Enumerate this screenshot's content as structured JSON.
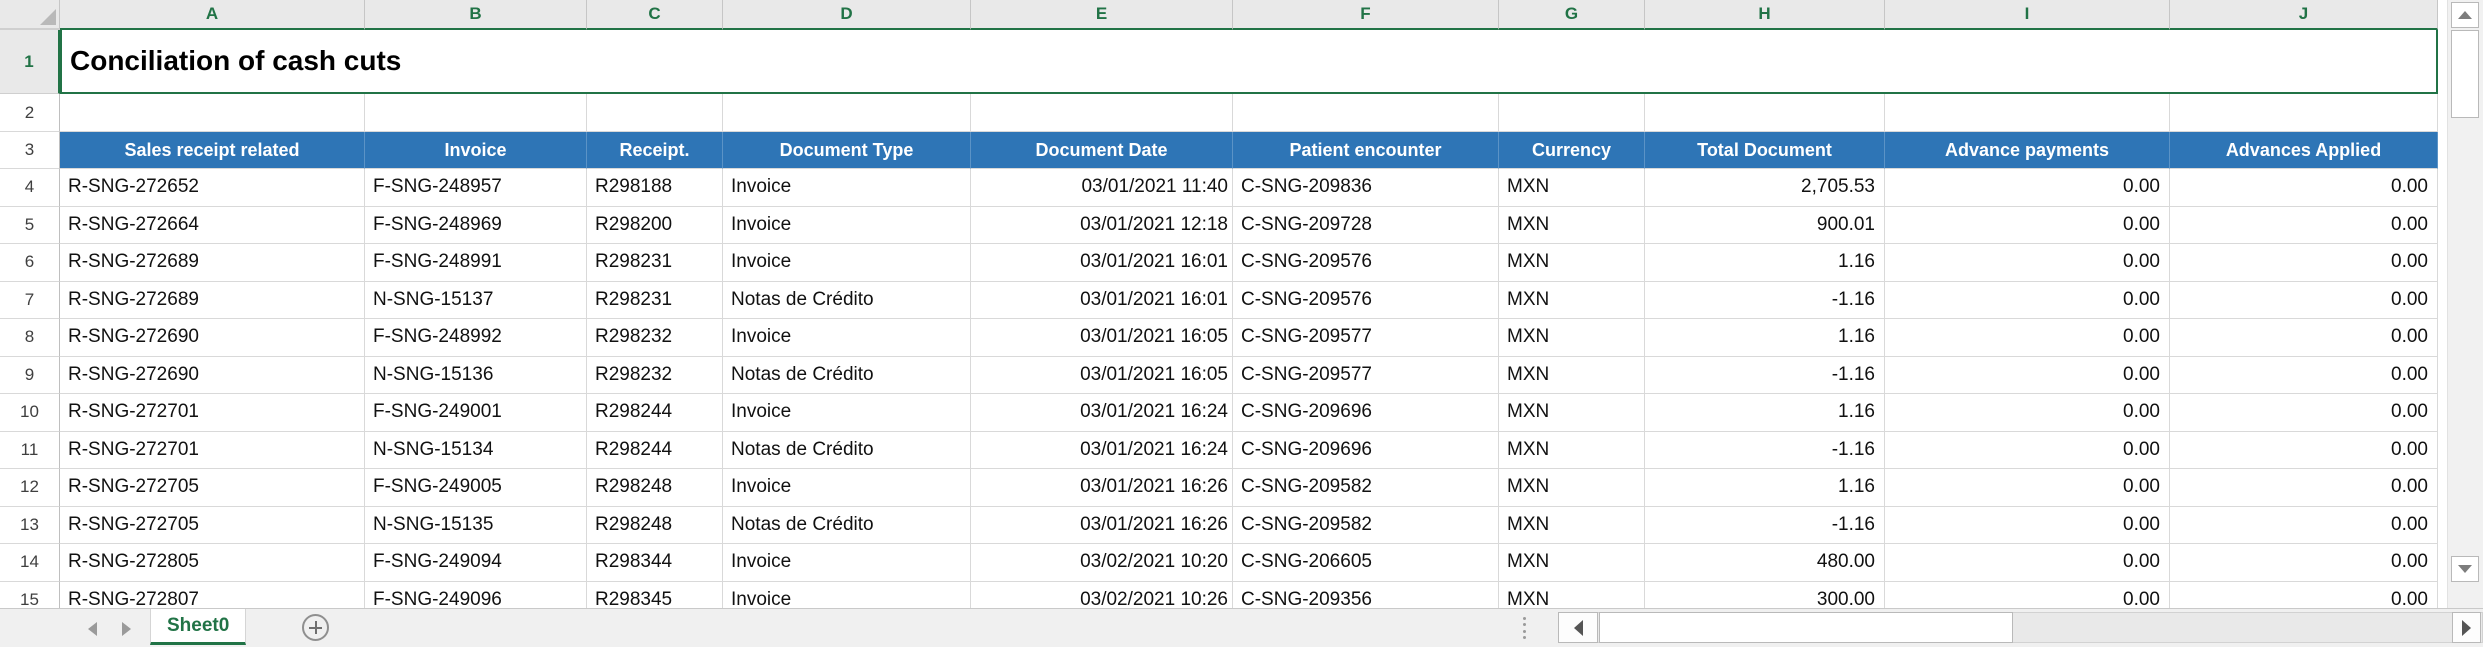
{
  "title": {
    "text": "Conciliation of cash cuts"
  },
  "grid": {
    "column_letters": [
      "A",
      "B",
      "C",
      "D",
      "E",
      "F",
      "G",
      "H",
      "I",
      "J"
    ],
    "row1_number": "1",
    "row2_number": "2",
    "header_row_number": "3",
    "headers": [
      "Sales receipt related",
      "Invoice",
      "Receipt.",
      "Document Type",
      "Document Date",
      "Patient encounter",
      "Currency",
      "Total Document",
      "Advance payments",
      "Advances Applied"
    ],
    "rows": [
      {
        "number": "4",
        "cells": [
          "R-SNG-272652",
          "F-SNG-248957",
          "R298188",
          "Invoice",
          "03/01/2021 11:40",
          "C-SNG-209836",
          "MXN",
          "2,705.53",
          "0.00",
          "0.00"
        ]
      },
      {
        "number": "5",
        "cells": [
          "R-SNG-272664",
          "F-SNG-248969",
          "R298200",
          "Invoice",
          "03/01/2021 12:18",
          "C-SNG-209728",
          "MXN",
          "900.01",
          "0.00",
          "0.00"
        ]
      },
      {
        "number": "6",
        "cells": [
          "R-SNG-272689",
          "F-SNG-248991",
          "R298231",
          "Invoice",
          "03/01/2021 16:01",
          "C-SNG-209576",
          "MXN",
          "1.16",
          "0.00",
          "0.00"
        ]
      },
      {
        "number": "7",
        "cells": [
          "R-SNG-272689",
          "N-SNG-15137",
          "R298231",
          "Notas de Crédito",
          "03/01/2021 16:01",
          "C-SNG-209576",
          "MXN",
          "-1.16",
          "0.00",
          "0.00"
        ]
      },
      {
        "number": "8",
        "cells": [
          "R-SNG-272690",
          "F-SNG-248992",
          "R298232",
          "Invoice",
          "03/01/2021 16:05",
          "C-SNG-209577",
          "MXN",
          "1.16",
          "0.00",
          "0.00"
        ]
      },
      {
        "number": "9",
        "cells": [
          "R-SNG-272690",
          "N-SNG-15136",
          "R298232",
          "Notas de Crédito",
          "03/01/2021 16:05",
          "C-SNG-209577",
          "MXN",
          "-1.16",
          "0.00",
          "0.00"
        ]
      },
      {
        "number": "10",
        "cells": [
          "R-SNG-272701",
          "F-SNG-249001",
          "R298244",
          "Invoice",
          "03/01/2021 16:24",
          "C-SNG-209696",
          "MXN",
          "1.16",
          "0.00",
          "0.00"
        ]
      },
      {
        "number": "11",
        "cells": [
          "R-SNG-272701",
          "N-SNG-15134",
          "R298244",
          "Notas de Crédito",
          "03/01/2021 16:24",
          "C-SNG-209696",
          "MXN",
          "-1.16",
          "0.00",
          "0.00"
        ]
      },
      {
        "number": "12",
        "cells": [
          "R-SNG-272705",
          "F-SNG-249005",
          "R298248",
          "Invoice",
          "03/01/2021 16:26",
          "C-SNG-209582",
          "MXN",
          "1.16",
          "0.00",
          "0.00"
        ]
      },
      {
        "number": "13",
        "cells": [
          "R-SNG-272705",
          "N-SNG-15135",
          "R298248",
          "Notas de Crédito",
          "03/01/2021 16:26",
          "C-SNG-209582",
          "MXN",
          "-1.16",
          "0.00",
          "0.00"
        ]
      },
      {
        "number": "14",
        "cells": [
          "R-SNG-272805",
          "F-SNG-249094",
          "R298344",
          "Invoice",
          "03/02/2021 10:20",
          "C-SNG-206605",
          "MXN",
          "480.00",
          "0.00",
          "0.00"
        ]
      },
      {
        "number": "15",
        "cells": [
          "R-SNG-272807",
          "F-SNG-249096",
          "R298345",
          "Invoice",
          "03/02/2021 10:26",
          "C-SNG-209356",
          "MXN",
          "300.00",
          "0.00",
          "0.00"
        ]
      }
    ],
    "column_alignments": [
      "left",
      "left",
      "left",
      "left",
      "right",
      "left",
      "left",
      "right",
      "right",
      "right"
    ]
  },
  "sheet_bar": {
    "active_tab": "Sheet0"
  },
  "icons": {
    "select_all_corner": "corner-triangle-icon",
    "add_sheet": "plus-circle-icon",
    "tab_nav_left": "triangle-left-icon",
    "tab_nav_right": "triangle-right-icon",
    "scroll_up": "triangle-up-icon",
    "scroll_down": "triangle-down-icon",
    "scroll_left": "triangle-left-icon",
    "scroll_right": "triangle-right-icon",
    "tab_splitter": "vertical-dots-icon"
  },
  "colors": {
    "accent_green": "#217346",
    "header_blue": "#2E75B6",
    "header_text": "#FFFFFF"
  }
}
